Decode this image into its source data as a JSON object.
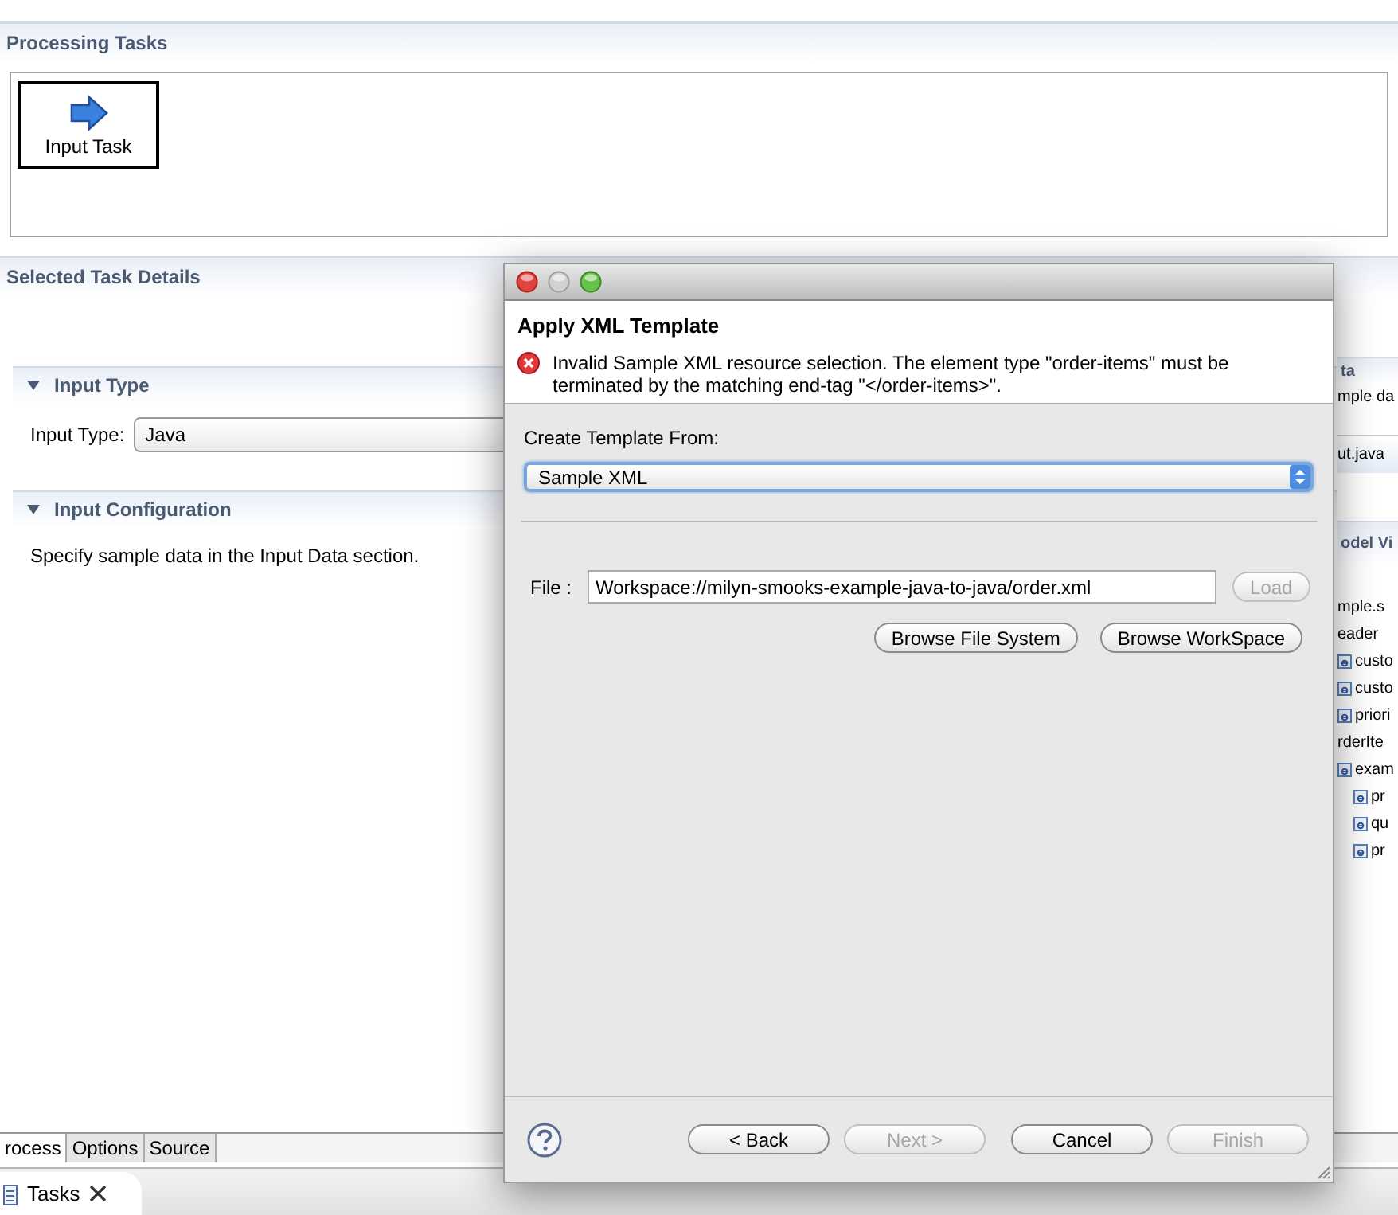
{
  "editor": {
    "processing_title": "Processing Tasks",
    "tasks": [
      {
        "label": "Input Task",
        "selected": true
      }
    ],
    "details_title": "Selected Task Details",
    "sections": [
      {
        "title": "Input Type",
        "expanded": true,
        "field_label": "Input Type:",
        "field_value": "Java"
      },
      {
        "title": "Input Configuration",
        "expanded": true,
        "text": "Specify sample data in the Input Data section."
      }
    ],
    "right_panel": {
      "section_title": "ta",
      "section_text": "mple da",
      "file": "ut.java",
      "view_title": "odel Vi",
      "tree": [
        {
          "label": "mple.s",
          "kind": "plain",
          "children": [
            {
              "label": "eader",
              "kind": "plain",
              "children": [
                {
                  "label": "custo",
                  "kind": "element"
                },
                {
                  "label": "custo",
                  "kind": "element"
                },
                {
                  "label": "priori",
                  "kind": "element"
                }
              ]
            },
            {
              "label": "rderIte",
              "kind": "plain",
              "children": [
                {
                  "label": "exam",
                  "kind": "element",
                  "children": [
                    {
                      "label": "pr",
                      "kind": "element"
                    },
                    {
                      "label": "qu",
                      "kind": "element"
                    },
                    {
                      "label": "pr",
                      "kind": "element"
                    }
                  ]
                }
              ]
            }
          ]
        }
      ]
    },
    "bottom_tabs": [
      {
        "label": "rocess",
        "selected": true
      },
      {
        "label": "Options",
        "selected": false
      },
      {
        "label": "Source",
        "selected": false
      }
    ]
  },
  "view_tabs": [
    {
      "label": "Tasks",
      "selected": true,
      "closable": true
    }
  ],
  "dialog": {
    "title": "Apply XML Template",
    "error": "Invalid Sample XML resource selection.  The element type \"order-items\" must be terminated by the matching end-tag \"</order-items>\".",
    "source_label": "Create Template From:",
    "source_value": "Sample XML",
    "file_label": "File :",
    "file_value": "Workspace://milyn-smooks-example-java-to-java/order.xml",
    "file_buttons": [
      {
        "label": "Load",
        "disabled": true
      }
    ],
    "browse_buttons": [
      {
        "label": "Browse File System",
        "disabled": false
      },
      {
        "label": "Browse WorkSpace",
        "disabled": false
      }
    ],
    "footer_buttons": [
      {
        "label": "< Back",
        "disabled": false
      },
      {
        "label": "Next >",
        "disabled": true
      },
      {
        "label": "Cancel",
        "disabled": false
      },
      {
        "label": "Finish",
        "disabled": true
      }
    ]
  }
}
